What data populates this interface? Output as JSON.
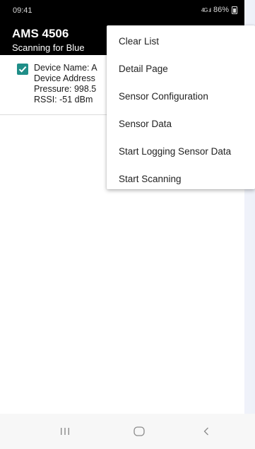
{
  "status_bar": {
    "time": "09:41",
    "signal": "4G .ıl",
    "battery": "86%"
  },
  "app_bar": {
    "title": "AMS 4506",
    "subtitle": "Scanning for Blue"
  },
  "device": {
    "checked": true,
    "name_line": "Device Name: A",
    "address_line": "Device Address",
    "pressure_line": "Pressure: 998.5",
    "rssi_line": "RSSI: -51 dBm"
  },
  "menu": {
    "items": [
      {
        "label": "Clear List"
      },
      {
        "label": "Detail Page"
      },
      {
        "label": "Sensor Configuration"
      },
      {
        "label": "Sensor Data"
      },
      {
        "label": "Start Logging Sensor Data"
      },
      {
        "label": "Start Scanning"
      }
    ]
  },
  "nav_bar": {
    "icons": [
      "recents-icon",
      "home-icon",
      "back-icon"
    ]
  },
  "colors": {
    "accent": "#1f8e88",
    "app_bar": "#000000"
  }
}
